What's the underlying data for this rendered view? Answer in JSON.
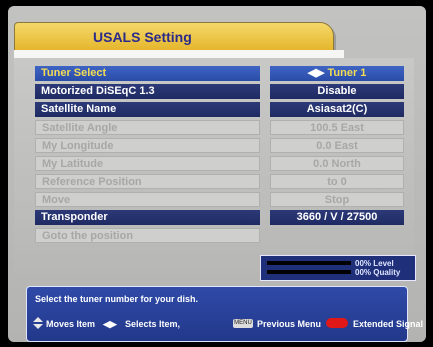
{
  "title": "USALS Setting",
  "rows": [
    {
      "label": "Tuner Select",
      "value": "Tuner 1",
      "state": "selected"
    },
    {
      "label": "Motorized DiSEqC 1.3",
      "value": "Disable",
      "state": "active"
    },
    {
      "label": "Satellite Name",
      "value": "Asiasat2(C)",
      "state": "active"
    },
    {
      "label": "Satellite Angle",
      "value": "100.5 East",
      "state": "disabled"
    },
    {
      "label": "My Longitude",
      "value": "0.0 East",
      "state": "disabled"
    },
    {
      "label": "My Latitude",
      "value": "0.0 North",
      "state": "disabled"
    },
    {
      "label": "Reference Position",
      "value": "to 0",
      "state": "disabled"
    },
    {
      "label": "Move",
      "value": "Stop",
      "state": "disabled"
    },
    {
      "label": "Transponder",
      "value": "3660 / V / 27500",
      "state": "active"
    },
    {
      "label": "Goto the position",
      "value": "",
      "state": "disabled"
    }
  ],
  "signal": {
    "level": "00% Level",
    "quality": "00% Quality",
    "level_pct": 0,
    "quality_pct": 0
  },
  "help": {
    "message": "Select the tuner number for your dish.",
    "hint_move": "Moves Item",
    "hint_select": "Selects Item,",
    "hint_prev": "Previous Menu",
    "hint_ext": "Extended Signal"
  },
  "icons": {
    "tuner_arrows": "left-right-arrows-icon",
    "menu_key": "menu-key-icon",
    "red_key": "red-oval-icon",
    "updown": "up-down-arrows-icon"
  },
  "colors": {
    "highlight": "#3e64c4",
    "active": "#1f2a62",
    "title_tab": "#e5b52a",
    "help_bg": "#22388a",
    "red_key": "#e01818"
  }
}
